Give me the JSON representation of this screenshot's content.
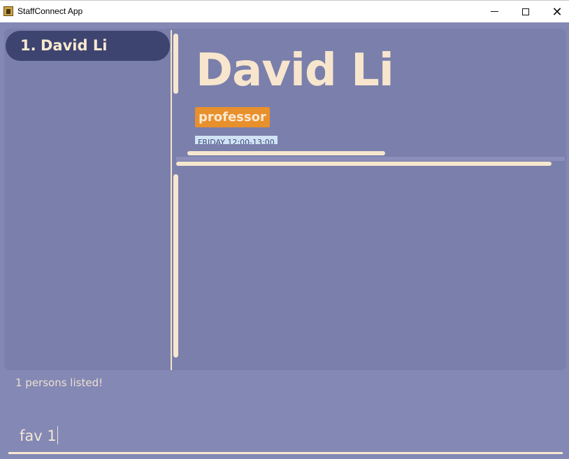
{
  "window": {
    "title": "StaffConnect App",
    "icon": "app-icon",
    "controls": [
      "minimize-icon",
      "maximize-icon",
      "close-icon"
    ],
    "close_glyph": "✕"
  },
  "person_list": {
    "items": [
      {
        "index": "1.",
        "name": "David Li"
      }
    ]
  },
  "person_detail": {
    "name": "David Li",
    "tags": [
      "professor"
    ],
    "schedule": "FRIDAY 12:00-13:00"
  },
  "result_display": {
    "text": "1 persons listed!"
  },
  "command_box": {
    "value": "fav 1"
  },
  "colors": {
    "background": "#8488b4",
    "panel": "#7b7fab",
    "selected_card": "#3e4470",
    "accent_text": "#f7e6cd",
    "tag": "#e8902c",
    "schedule_chip": "#cfe3f5"
  }
}
